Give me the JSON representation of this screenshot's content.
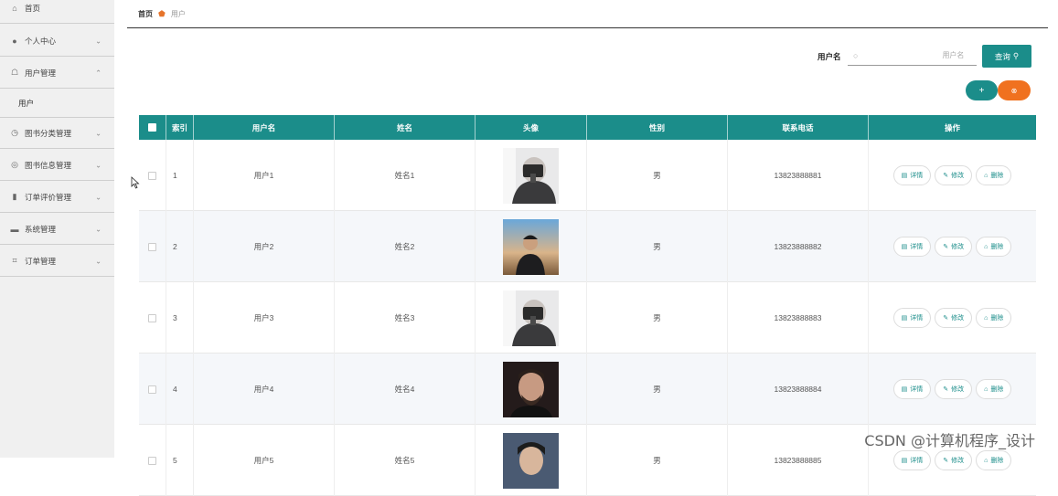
{
  "sidebar": {
    "items": [
      {
        "label": "首页",
        "icon": "home-icon",
        "glyph": "⌂"
      },
      {
        "label": "个人中心",
        "icon": "user-icon",
        "glyph": "●"
      },
      {
        "label": "用户管理",
        "icon": "users-icon",
        "glyph": "☖",
        "expanded": true
      },
      {
        "label": "图书分类管理",
        "icon": "clock-icon",
        "glyph": "◷"
      },
      {
        "label": "图书信息管理",
        "icon": "compass-icon",
        "glyph": "◎"
      },
      {
        "label": "订单评价管理",
        "icon": "bar-chart-icon",
        "glyph": "▮"
      },
      {
        "label": "系统管理",
        "icon": "message-icon",
        "glyph": "▬"
      },
      {
        "label": "订单管理",
        "icon": "crop-icon",
        "glyph": "⌗"
      }
    ],
    "sub_item": "用户"
  },
  "breadcrumb": {
    "home": "首页",
    "current": "用户"
  },
  "search": {
    "label": "用户名",
    "placeholder": "用户名",
    "button": "查询"
  },
  "actions": {
    "add": "+",
    "delete": "⊗"
  },
  "table": {
    "headers": [
      "索引",
      "用户名",
      "姓名",
      "头像",
      "性别",
      "联系电话",
      "操作"
    ],
    "rows": [
      {
        "index": "1",
        "username": "用户1",
        "name": "姓名1",
        "gender": "男",
        "phone": "13823888881",
        "avatar": "a"
      },
      {
        "index": "2",
        "username": "用户2",
        "name": "姓名2",
        "gender": "男",
        "phone": "13823888882",
        "avatar": "b"
      },
      {
        "index": "3",
        "username": "用户3",
        "name": "姓名3",
        "gender": "男",
        "phone": "13823888883",
        "avatar": "a"
      },
      {
        "index": "4",
        "username": "用户4",
        "name": "姓名4",
        "gender": "男",
        "phone": "13823888884",
        "avatar": "c"
      },
      {
        "index": "5",
        "username": "用户5",
        "name": "姓名5",
        "gender": "男",
        "phone": "13823888885",
        "avatar": "d"
      }
    ],
    "row_actions": {
      "detail": "详情",
      "edit": "修改",
      "remove": "删除"
    }
  },
  "watermark": "CSDN @计算机程序_设计",
  "colors": {
    "primary": "#1b8d8a",
    "danger": "#f0711f"
  }
}
